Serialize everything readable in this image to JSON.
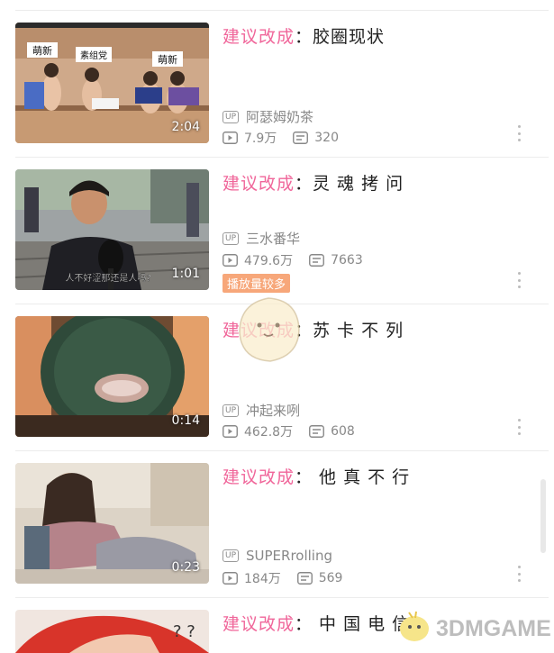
{
  "colors": {
    "accent": "#f0669a",
    "meta": "#888888",
    "hot_badge": "#f7a77a"
  },
  "videos": [
    {
      "title_prefix": "建议改成",
      "title_suffix": "：胶圈现状",
      "duration": "2:04",
      "up_label": "UP",
      "uploader": "阿瑟姆奶茶",
      "views": "7.9万",
      "danmaku": "320",
      "thumb_captions": [
        "萌新",
        "素组党",
        "萌新"
      ]
    },
    {
      "title_prefix": "建议改成",
      "title_suffix": "：灵 魂 拷 问",
      "duration": "1:01",
      "up_label": "UP",
      "uploader": "三水番华",
      "views": "479.6万",
      "danmaku": "7663",
      "badge": "播放量较多",
      "subtitle": "人不好涩那还是人吗?"
    },
    {
      "title_prefix": "建议改成",
      "title_suffix": "：苏 卡 不 列",
      "duration": "0:14",
      "up_label": "UP",
      "uploader": "冲起来咧",
      "views": "462.8万",
      "danmaku": "608"
    },
    {
      "title_prefix": "建议改成",
      "title_suffix": "： 他 真 不 行",
      "duration": "0:23",
      "up_label": "UP",
      "uploader": "SUPERrolling",
      "views": "184万",
      "danmaku": "569"
    },
    {
      "title_prefix": "建议改成",
      "title_suffix": "： 中 国 电 信"
    }
  ],
  "watermark": {
    "text": "3DMGAME"
  },
  "icons": {
    "play": "play-count-icon",
    "danmaku": "danmaku-icon",
    "more": "more-vertical-icon"
  }
}
